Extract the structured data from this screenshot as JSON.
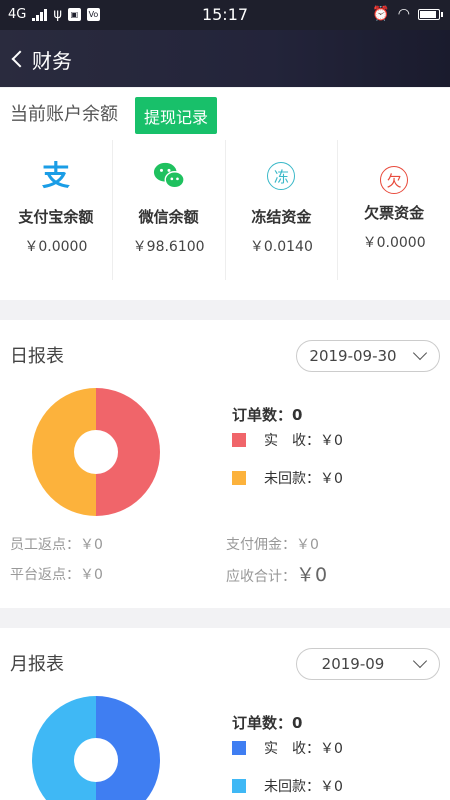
{
  "status_bar": {
    "network": "4G",
    "time": "15:17",
    "mini_icon_text": "Vo"
  },
  "header": {
    "title": "财务"
  },
  "balance": {
    "label": "当前账户余额",
    "withdraw_label": "提现记录",
    "items": [
      {
        "name": "支付宝余额",
        "value": "￥0.0000",
        "icon": "alipay-icon",
        "glyph": "支"
      },
      {
        "name": "微信余额",
        "value": "￥98.6100",
        "icon": "wechat-icon",
        "glyph": ""
      },
      {
        "name": "冻结资金",
        "value": "￥0.0140",
        "icon": "frozen-icon",
        "glyph": "冻"
      },
      {
        "name": "欠票资金",
        "value": "￥0.0000",
        "icon": "owed-icon",
        "glyph": "欠"
      }
    ]
  },
  "daily": {
    "title": "日报表",
    "date": "2019-09-30",
    "order_count": "订单数：0",
    "legend": [
      {
        "label": "实　收：￥0",
        "color": "#f0656a"
      },
      {
        "label": "未回款：￥0",
        "color": "#fcb23c"
      }
    ],
    "stats": {
      "staff_rebate": "员工返点：￥0",
      "payment_commission": "支付佣金：￥0",
      "platform_rebate": "平台返点：￥0",
      "receivable_label": "应收合计：",
      "receivable_value": "￥0"
    },
    "colors": {
      "left": "#fcb23c",
      "right": "#f0656a"
    }
  },
  "monthly": {
    "title": "月报表",
    "date": "2019-09",
    "order_count": "订单数：0",
    "legend": [
      {
        "label": "实　收：￥0",
        "color": "#3f7ef2"
      },
      {
        "label": "未回款：￥0",
        "color": "#3fb8f5"
      }
    ],
    "colors": {
      "left": "#3fb8f5",
      "right": "#3f7ef2"
    }
  }
}
